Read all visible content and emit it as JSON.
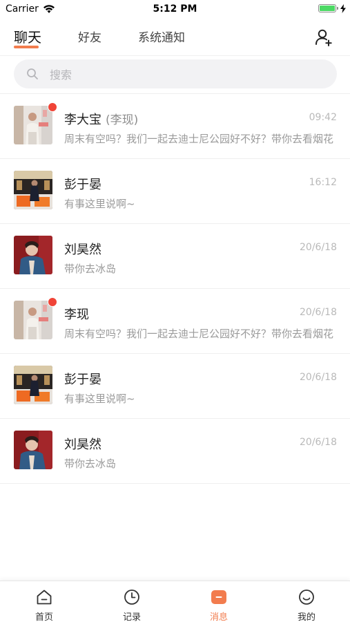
{
  "status_bar": {
    "carrier": "Carrier",
    "time": "5:12 PM",
    "battery_level": 1.0
  },
  "tabs": [
    {
      "label": "聊天",
      "active": true
    },
    {
      "label": "好友",
      "active": false
    },
    {
      "label": "系统通知",
      "active": false
    }
  ],
  "search": {
    "placeholder": "搜索",
    "value": ""
  },
  "chats": [
    {
      "name": "李大宝",
      "sub_name": "(李现)",
      "time": "09:42",
      "message": "周末有空吗？我们一起去迪士尼公园好不好？带你去看烟花",
      "unread": true,
      "avatar": "street-photo"
    },
    {
      "name": "彭于晏",
      "sub_name": "",
      "time": "16:12",
      "message": "有事这里说啊~",
      "unread": false,
      "avatar": "orange-chair-photo"
    },
    {
      "name": "刘昊然",
      "sub_name": "",
      "time": "20/6/18",
      "message": "带你去冰岛",
      "unread": false,
      "avatar": "red-portrait-photo"
    },
    {
      "name": "李现",
      "sub_name": "",
      "time": "20/6/18",
      "message": "周末有空吗？我们一起去迪士尼公园好不好？带你去看烟花",
      "unread": true,
      "avatar": "street-photo"
    },
    {
      "name": "彭于晏",
      "sub_name": "",
      "time": "20/6/18",
      "message": "有事这里说啊~",
      "unread": false,
      "avatar": "orange-chair-photo"
    },
    {
      "name": "刘昊然",
      "sub_name": "",
      "time": "20/6/18",
      "message": "带你去冰岛",
      "unread": false,
      "avatar": "red-portrait-photo"
    }
  ],
  "bottom_nav": [
    {
      "label": "首页",
      "icon": "home-icon",
      "active": false
    },
    {
      "label": "记录",
      "icon": "clock-icon",
      "active": false
    },
    {
      "label": "消息",
      "icon": "message-icon",
      "active": true
    },
    {
      "label": "我的",
      "icon": "smile-icon",
      "active": false
    }
  ],
  "colors": {
    "accent": "#f27c4e",
    "badge": "#f04437",
    "battery": "#4cd964"
  }
}
